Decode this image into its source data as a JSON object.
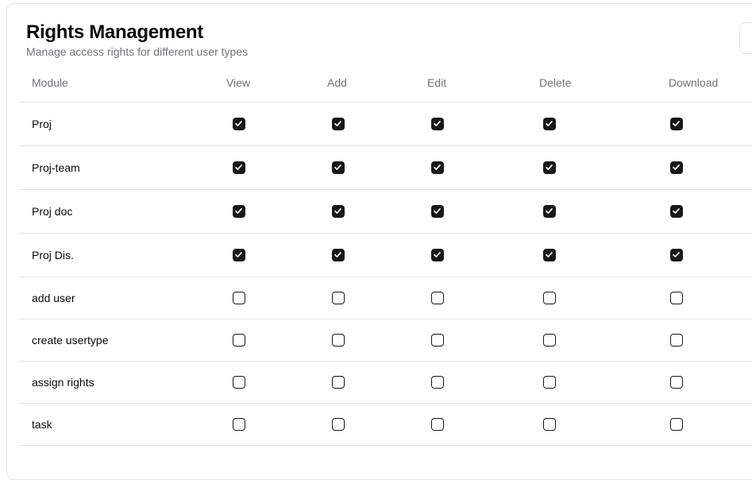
{
  "header": {
    "title": "Rights Management",
    "subtitle": "Manage access rights for different user types"
  },
  "table": {
    "columns": [
      "Module",
      "View",
      "Add",
      "Edit",
      "Delete",
      "Download"
    ],
    "rows": [
      {
        "module": "Proj",
        "view": true,
        "add": true,
        "edit": true,
        "delete": true,
        "download": true
      },
      {
        "module": "Proj-team",
        "view": true,
        "add": true,
        "edit": true,
        "delete": true,
        "download": true
      },
      {
        "module": "Proj doc",
        "view": true,
        "add": true,
        "edit": true,
        "delete": true,
        "download": true
      },
      {
        "module": "Proj Dis.",
        "view": true,
        "add": true,
        "edit": true,
        "delete": true,
        "download": true
      },
      {
        "module": "add user",
        "view": false,
        "add": false,
        "edit": false,
        "delete": false,
        "download": false
      },
      {
        "module": "create usertype",
        "view": false,
        "add": false,
        "edit": false,
        "delete": false,
        "download": false
      },
      {
        "module": "assign rights",
        "view": false,
        "add": false,
        "edit": false,
        "delete": false,
        "download": false
      },
      {
        "module": "task",
        "view": false,
        "add": false,
        "edit": false,
        "delete": false,
        "download": false
      }
    ]
  },
  "colors": {
    "checkbox_checked": "#18181b",
    "border": "#e4e4e7",
    "muted_text": "#71717a"
  },
  "icons": {
    "checkmark": "check-icon"
  }
}
